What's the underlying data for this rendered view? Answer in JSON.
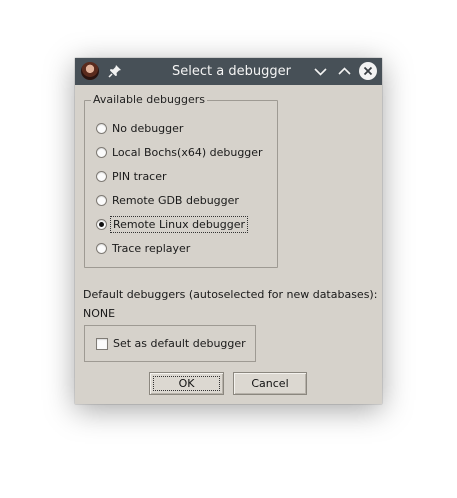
{
  "window": {
    "title": "Select a debugger"
  },
  "titlebar_icons": {
    "app": "app-avatar-icon",
    "pin": "pin-icon",
    "minimize": "chevron-down-icon",
    "maximize": "chevron-up-icon",
    "close": "close-icon"
  },
  "debuggers": {
    "group_title": "Available debuggers",
    "options": [
      {
        "label": "No debugger",
        "checked": false
      },
      {
        "label": "Local Bochs(x64) debugger",
        "checked": false
      },
      {
        "label": "PIN tracer",
        "checked": false
      },
      {
        "label": "Remote GDB debugger",
        "checked": false
      },
      {
        "label": "Remote Linux debugger",
        "checked": true
      },
      {
        "label": "Trace replayer",
        "checked": false
      }
    ]
  },
  "defaults": {
    "label": "Default debuggers (autoselected for new databases):",
    "value": "NONE",
    "checkbox_label": "Set as default debugger",
    "checkbox_checked": false
  },
  "buttons": {
    "ok": "OK",
    "cancel": "Cancel"
  },
  "colors": {
    "titlebar": "#475057",
    "dialog_bg": "#d6d2cb"
  }
}
